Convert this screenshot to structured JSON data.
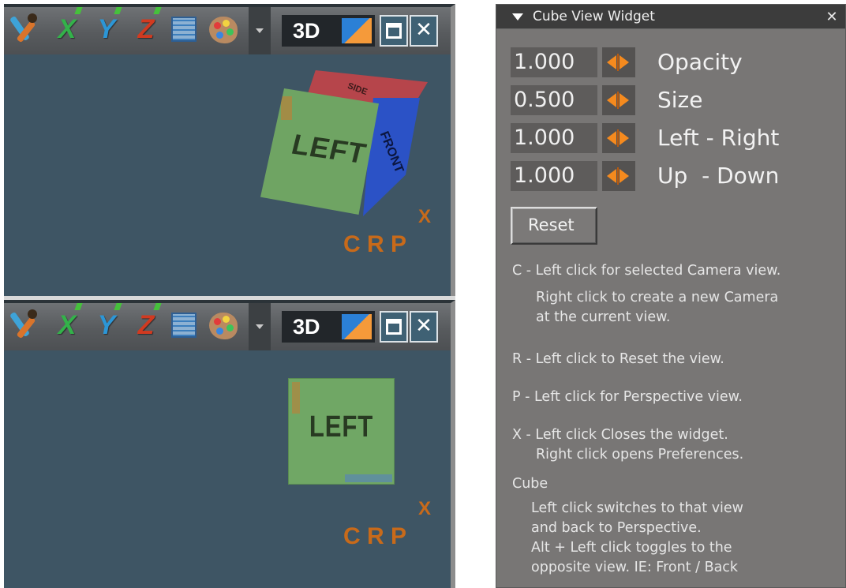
{
  "viewports": [
    {
      "toolbar": {
        "icons": [
          "tool-icon",
          "x-axis-icon",
          "y-axis-icon",
          "z-axis-icon",
          "grid-icon",
          "palette-icon",
          "chevron-down-icon"
        ],
        "x_label": "X",
        "y_label": "Y",
        "z_label": "Z",
        "mode_label": "3D",
        "close_glyph": "✕"
      },
      "cube": {
        "view": "perspective",
        "face_front": "LEFT",
        "face_top": "SIDE",
        "face_side": "FRONT"
      },
      "cube_buttons": {
        "c": "C",
        "r": "R",
        "p": "P",
        "x": "X"
      }
    },
    {
      "toolbar": {
        "icons": [
          "tool-icon",
          "x-axis-icon",
          "y-axis-icon",
          "z-axis-icon",
          "grid-icon",
          "palette-icon",
          "chevron-down-icon"
        ],
        "x_label": "X",
        "y_label": "Y",
        "z_label": "Z",
        "mode_label": "3D",
        "close_glyph": "✕"
      },
      "cube": {
        "view": "flat",
        "face_front": "LEFT"
      },
      "cube_buttons": {
        "c": "C",
        "r": "R",
        "p": "P",
        "x": "X"
      }
    }
  ],
  "widget": {
    "title": "Cube View Widget",
    "close_glyph": "✕",
    "params": [
      {
        "value": "1.000",
        "label": "Opacity"
      },
      {
        "value": "0.500",
        "label": "Size"
      },
      {
        "value": "1.000",
        "label": "Left - Right"
      },
      {
        "value": "1.000",
        "label": "Up  - Down"
      }
    ],
    "reset_label": "Reset",
    "help": {
      "c_line1": "C - Left click for selected Camera view.",
      "c_line2": "Right click to create a new Camera",
      "c_line3": "at the current view.",
      "r_line": "R - Left click to Reset the view.",
      "p_line": "P - Left click for Perspective view.",
      "x_line1": "X - Left click Closes the widget.",
      "x_line2": "Right click opens Preferences.",
      "cube_heading": "Cube",
      "cube_line1": "Left click switches to that view",
      "cube_line2": "and back to Perspective.",
      "cube_line3": "Alt + Left click toggles to the",
      "cube_line4": "opposite view. IE: Front / Back"
    }
  },
  "colors": {
    "viewport_bg": "#3e5564",
    "accent_orange": "#f58a1e",
    "crp_orange": "#c86a1a",
    "panel_bg": "#787675"
  }
}
